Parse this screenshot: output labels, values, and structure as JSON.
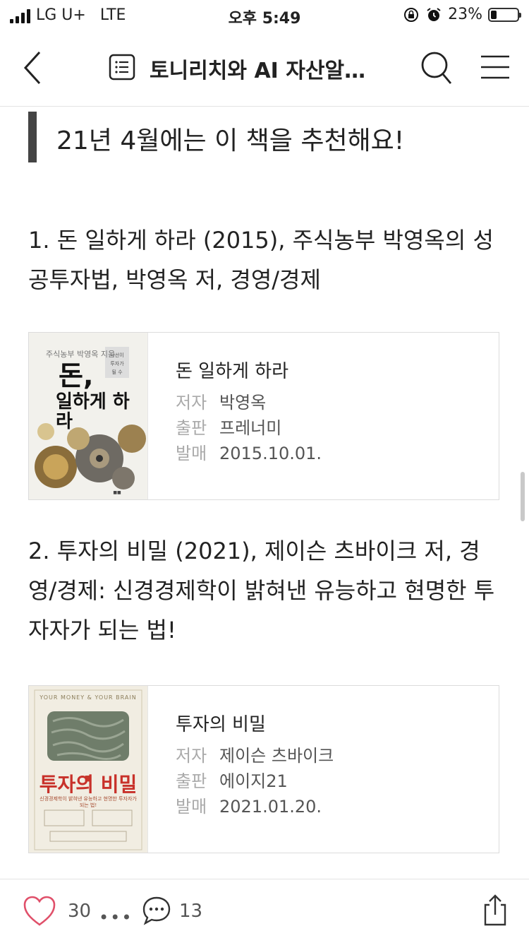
{
  "status_bar": {
    "carrier": "LG U+",
    "network": "LTE",
    "time": "오후 5:49",
    "battery": "23%",
    "battery_level": 0.23
  },
  "nav": {
    "title": "토니리치와 AI 자산알…",
    "icons": [
      "back-chevron-icon",
      "list-icon",
      "search-icon",
      "hamburger-menu-icon"
    ]
  },
  "post": {
    "quote": "21년 4월에는 이 책을 추천해요!",
    "item1_text": "1. 돈 일하게 하라 (2015), 주식농부 박영옥의 성공투자법, 박영옥 저, 경영/경제",
    "book1": {
      "title": "돈 일하게 하라",
      "author_label": "저자",
      "author": "박영옥",
      "publisher_label": "출판",
      "publisher": "프레너미",
      "date_label": "발매",
      "date": "2015.10.01.",
      "cover_text_main": "돈,",
      "cover_text_sub": "일하게 하라",
      "cover_small": "주식농부 박영옥 지음"
    },
    "item2_text": "2. 투자의 비밀 (2021), 제이슨 츠바이크 저, 경영/경제: 신경경제학이 밝혀낸 유능하고 현명한 투자자가 되는 법!",
    "book2": {
      "title": "투자의 비밀",
      "author_label": "저자",
      "author": "제이슨 츠바이크",
      "publisher_label": "출판",
      "publisher": "에이지21",
      "date_label": "발매",
      "date": "2021.01.20.",
      "cover_arc": "YOUR MONEY & YOUR BRAIN",
      "cover_title": "투자의 비밀",
      "cover_sub": "신경경제학이 밝혀낸 유능하고 현명한 투자자가 되는 법!"
    }
  },
  "bottom_bar": {
    "likes": "30",
    "comments": "13",
    "more": "•••"
  },
  "colors": {
    "heart": "#e0506a",
    "accent_bar": "#444444"
  }
}
